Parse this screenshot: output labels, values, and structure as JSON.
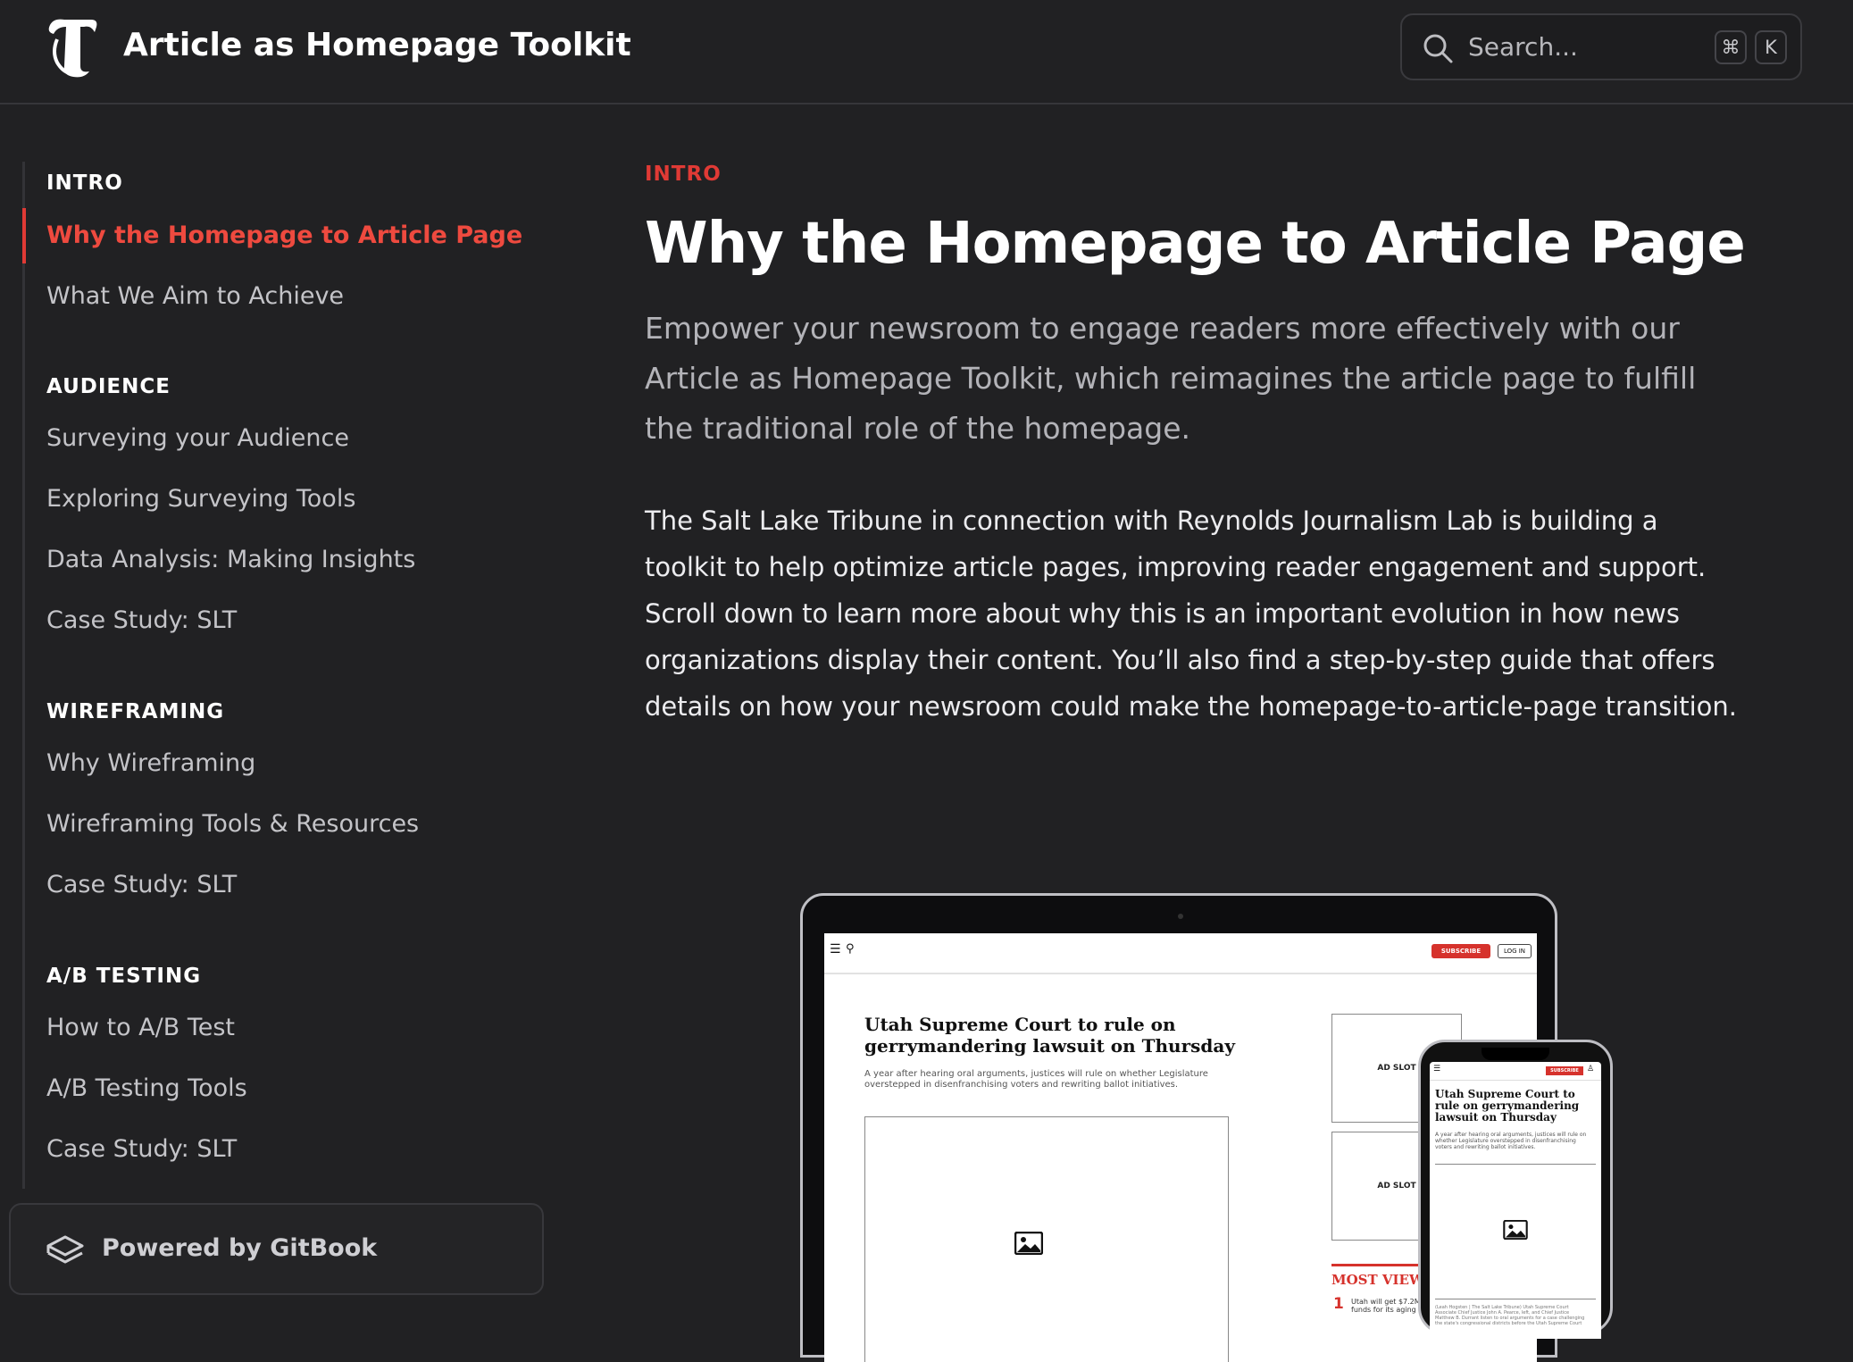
{
  "header": {
    "logo_icon": "tribune-t-logo-icon",
    "title": "Article as Homepage Toolkit",
    "search": {
      "placeholder": "Search...",
      "shortcut_modifier": "⌘",
      "shortcut_key": "K"
    }
  },
  "sidebar": {
    "sections": [
      {
        "heading": "INTRO",
        "items": [
          "Why the Homepage to Article Page",
          "What We Aim to Achieve"
        ]
      },
      {
        "heading": "AUDIENCE",
        "items": [
          "Surveying your Audience",
          "Exploring Surveying Tools",
          "Data Analysis: Making Insights",
          "Case Study: SLT"
        ]
      },
      {
        "heading": "WIREFRAMING",
        "items": [
          "Why Wireframing",
          "Wireframing Tools & Resources",
          "Case Study: SLT"
        ]
      },
      {
        "heading": "A/B TESTING",
        "items": [
          "How to A/B Test",
          "A/B Testing Tools",
          "Case Study: SLT"
        ]
      }
    ],
    "active_item": "Why the Homepage to Article Page",
    "footer": {
      "label": "Powered by GitBook"
    }
  },
  "main": {
    "breadcrumb": "INTRO",
    "title": "Why the Homepage to Article Page",
    "lede": "Empower your newsroom to engage readers more effectively with our Article as Homepage Toolkit, which reimagines the article page to fulfill the traditional role of the homepage.",
    "body": "The Salt Lake Tribune in connection with Reynolds Journalism Lab is building a toolkit to help optimize article pages, improving reader engagement and support. Scroll down to learn more about why this is an important evolution in how news organizations display their content. You’ll also find a step-by-step guide that offers details on how your newsroom could make the homepage-to-article-page transition."
  },
  "hero": {
    "laptop": {
      "subscribe": "SUBSCRIBE",
      "login": "LOG IN",
      "headline": "Utah Supreme Court to rule on gerrymandering lawsuit on Thursday",
      "dek": "A year after hearing oral arguments, justices will rule on whether Legislature overstepped in disenfranchising voters and rewriting ballot initiatives.",
      "ad_slot_1": "AD SLOT",
      "ad_slot_2": "AD SLOT",
      "most_viewed": "MOST VIEW",
      "rank": "1",
      "rank_text": "Utah will get $7.2M in funds for its aging da"
    },
    "phone": {
      "subscribe": "SUBSCRIBE",
      "headline": "Utah Supreme Court to rule on gerrymandering lawsuit on Thursday",
      "dek": "A year after hearing oral arguments, justices will rule on whether Legislature overstepped in disenfranchising voters and rewriting ballot initiatives.",
      "caption": "(Leah Hogsten | The Salt Lake Tribune) Utah Supreme Court Associate Chief Justice John A. Pearce, left, and Chief Justice Matthew B. Durrant listen to oral arguments for a case challenging the state's congressional districts before the Utah Supreme Court"
    }
  }
}
